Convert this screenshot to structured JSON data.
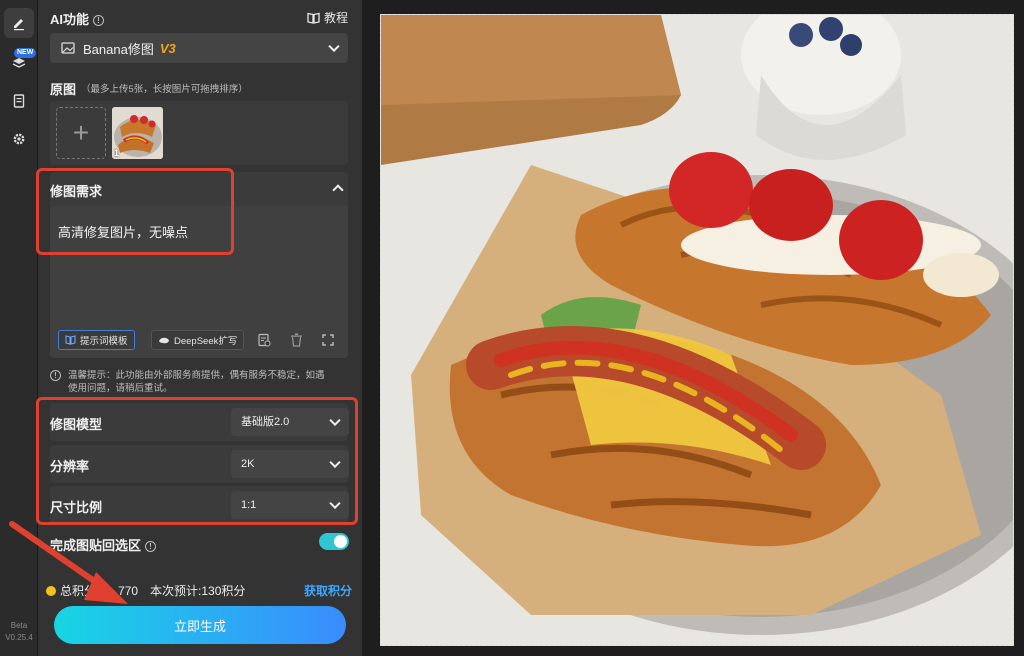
{
  "rail": {
    "new_badge": "NEW",
    "version_line1": "Beta",
    "version_line2": "V0.25.4"
  },
  "header": {
    "ai_title": "AI功能",
    "tutorial": "教程",
    "feature_select_name": "Banana修图",
    "feature_select_version": "V3"
  },
  "original": {
    "title": "原图",
    "hint": "（最多上传5张，长按图片可拖拽排序）",
    "thumb_index": "1"
  },
  "requirement": {
    "title": "修图需求",
    "text": "高清修复图片，无噪点",
    "template_btn": "提示词模板",
    "deepseek_btn": "DeepSeek扩写"
  },
  "notice": {
    "line1": "温馨提示：此功能由外部服务商提供，偶有服务不稳定，如遇",
    "line2": "使用问题，请稍后重试。"
  },
  "settings": {
    "model_label": "修图模型",
    "model_value": "基础版2.0",
    "resolution_label": "分辨率",
    "resolution_value": "2K",
    "ratio_label": "尺寸比例",
    "ratio_value": "1:1",
    "paste_back_label": "完成图贴回选区",
    "paste_back_on": true
  },
  "footer": {
    "total_label": "总积分",
    "total_value": "770",
    "estimate": "本次预计:130积分",
    "get_credits": "获取积分",
    "generate": "立即生成"
  },
  "colors": {
    "accent_red": "#e04030",
    "gradient_start": "#18d5e3",
    "gradient_end": "#3a8cff",
    "link_blue": "#3fa8ff",
    "toggle": "#31c5d3"
  }
}
